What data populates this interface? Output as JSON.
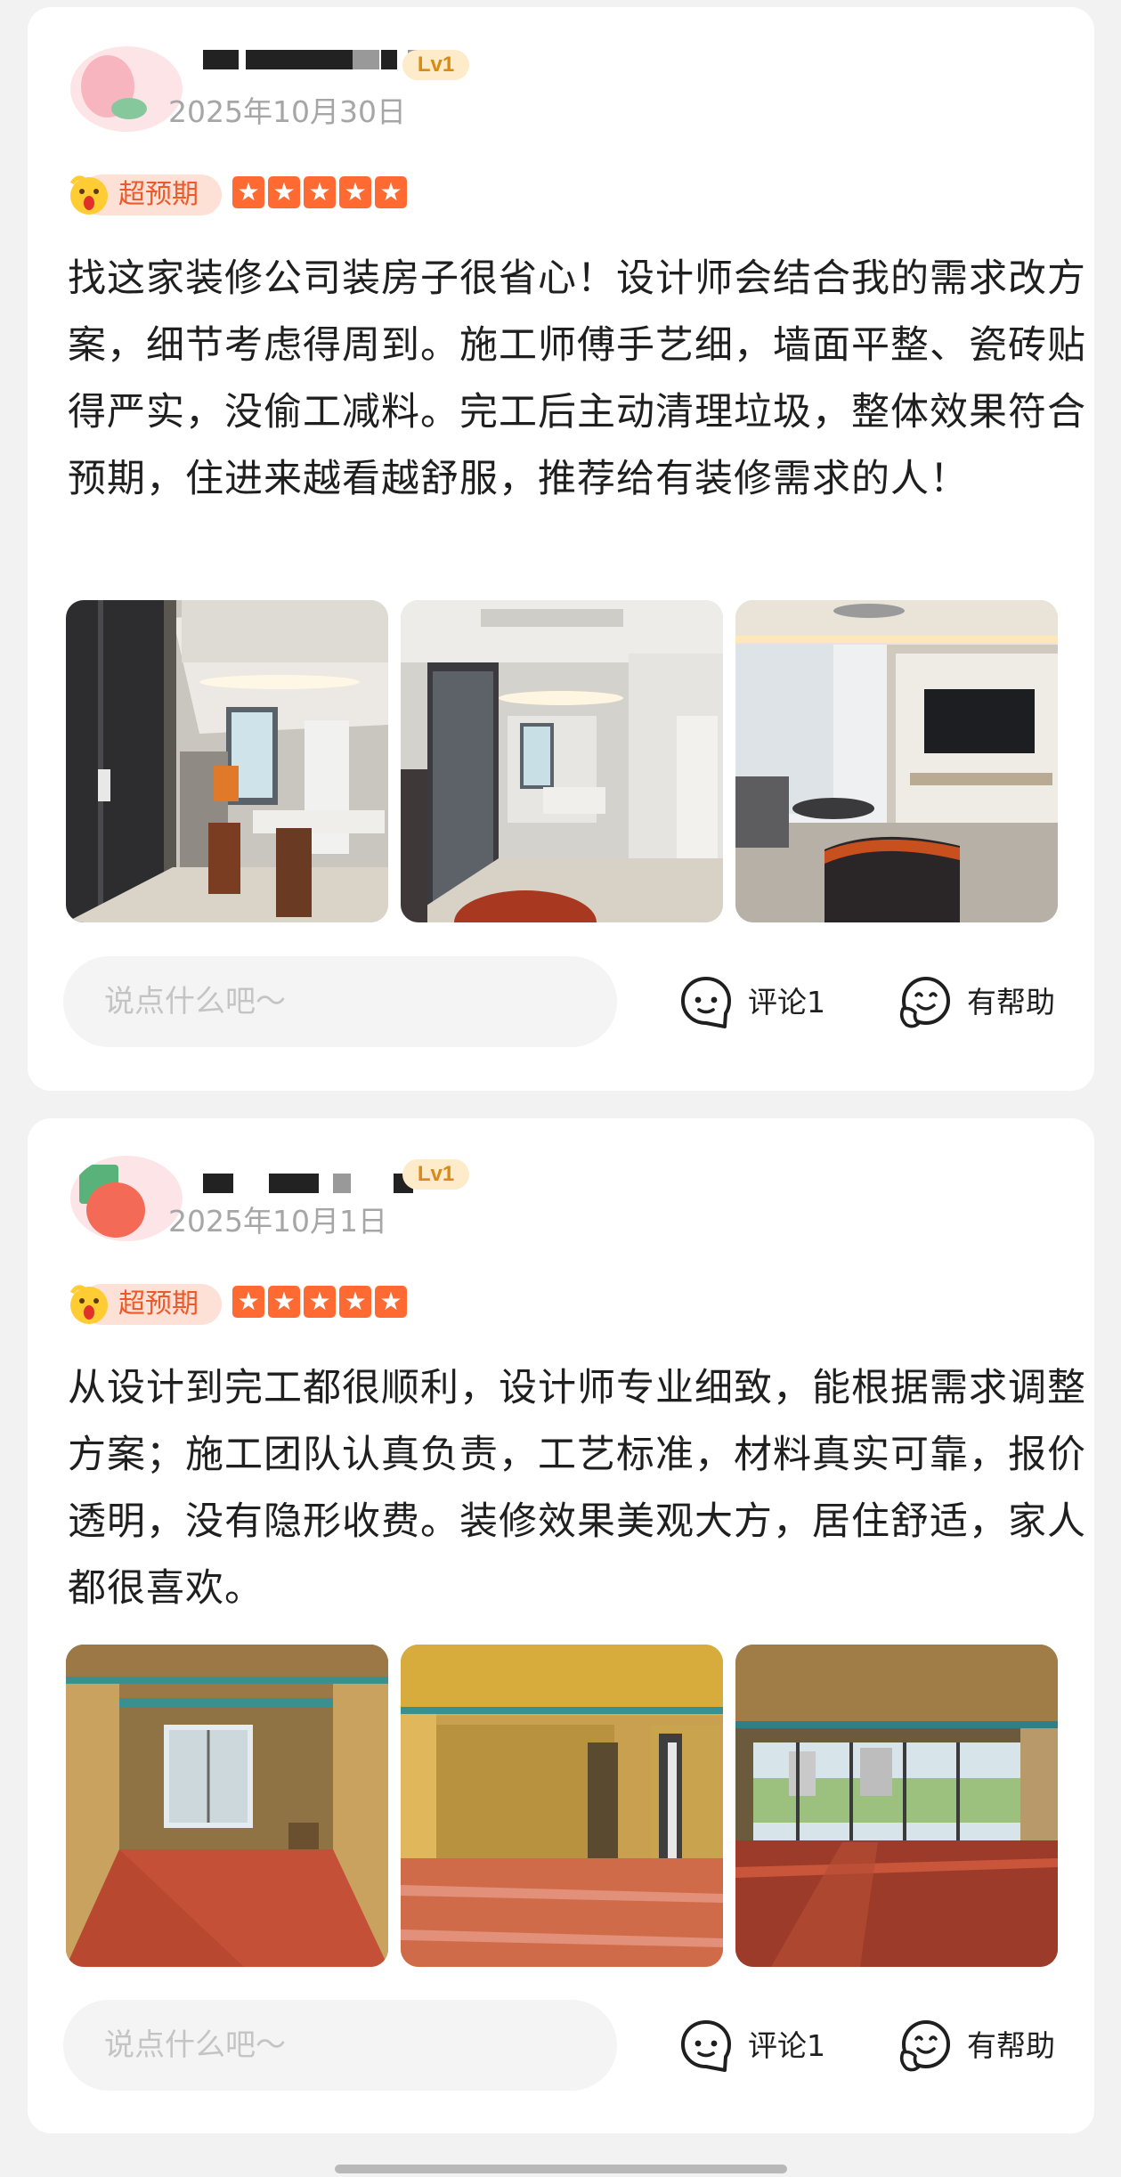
{
  "reviews": [
    {
      "level": "Lv1",
      "date": "2025年10月30日",
      "mood_label": "超预期",
      "rating": 5,
      "text": "找这家装修公司装房子很省心！设计师会结合我的需求改方案，细节考虑得周到。施工师傅手艺细，墙面平整、瓷砖贴得严实，没偷工减料。完工后主动清理垃圾，整体效果符合预期，住进来越看越舒服，推荐给有装修需求的人！",
      "comment_placeholder": "说点什么吧～",
      "comment_label": "评论1",
      "helpful_label": "有帮助"
    },
    {
      "level": "Lv1",
      "date": "2025年10月1日",
      "mood_label": "超预期",
      "rating": 5,
      "text": "从设计到完工都很顺利，设计师专业细致，能根据需求调整方案；施工团队认真负责，工艺标准，材料真实可靠，报价透明，没有隐形收费。装修效果美观大方，居住舒适，家人都很喜欢。",
      "comment_placeholder": "说点什么吧～",
      "comment_label": "评论1",
      "helpful_label": "有帮助"
    }
  ],
  "icons": {
    "star": "star-icon",
    "mood": "shocked-face-icon",
    "comment": "comment-bubble-icon",
    "helpful": "helpful-face-icon"
  },
  "colors": {
    "accent": "#ff6a33",
    "mood_text": "#ec5a2a",
    "level_badge_bg": "#fdebc9",
    "level_badge_text": "#d98a14",
    "date_text": "#a6a6a6"
  }
}
